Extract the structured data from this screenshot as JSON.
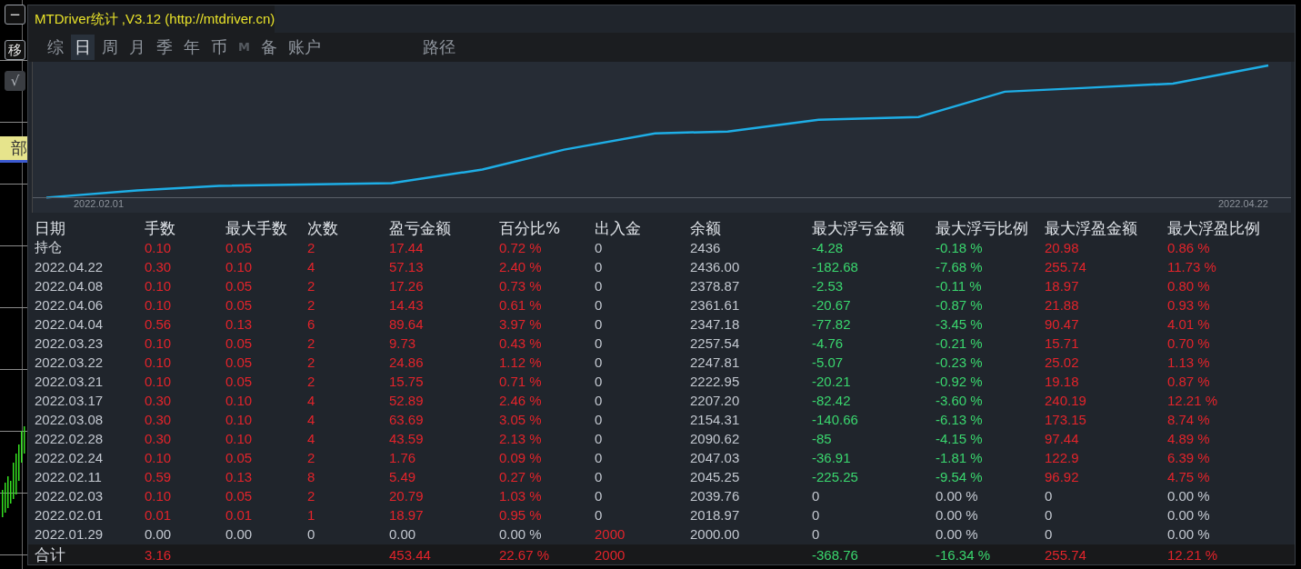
{
  "side_buttons": [
    {
      "label": "−"
    },
    {
      "label": "移"
    },
    {
      "label": "√",
      "disabled": true
    }
  ],
  "side_label": "部",
  "window": {
    "title": "MTDriver统计 ,V3.12 (http://mtdriver.cn)"
  },
  "tabs": [
    {
      "label": "综",
      "selected": false,
      "disabled": false
    },
    {
      "label": "日",
      "selected": true,
      "disabled": false
    },
    {
      "label": "周",
      "selected": false,
      "disabled": false
    },
    {
      "label": "月",
      "selected": false,
      "disabled": false
    },
    {
      "label": "季",
      "selected": false,
      "disabled": false
    },
    {
      "label": "年",
      "selected": false,
      "disabled": false
    },
    {
      "label": "币",
      "selected": false,
      "disabled": false
    },
    {
      "label": "M",
      "selected": false,
      "disabled": true
    },
    {
      "label": "备",
      "selected": false,
      "disabled": false
    },
    {
      "label": "账户",
      "selected": false,
      "disabled": false
    },
    {
      "label": "路径",
      "selected": false,
      "disabled": false
    }
  ],
  "chart": {
    "x_start_label": "2022.02.01",
    "x_end_label": "2022.04.22"
  },
  "table": {
    "columns": [
      "日期",
      "手数",
      "最大手数",
      "次数",
      "盈亏金额",
      "百分比%",
      "出入金",
      "余额",
      "最大浮亏金额",
      "最大浮亏比例",
      "最大浮盈金额",
      "最大浮盈比例"
    ],
    "rows": [
      {
        "cells": [
          {
            "text": "持仓",
            "color": "#d6dae0"
          },
          {
            "text": "0.10",
            "color": "#e3242b"
          },
          {
            "text": "0.05",
            "color": "#e3242b"
          },
          {
            "text": "2",
            "color": "#e3242b"
          },
          {
            "text": "17.44",
            "color": "#e3242b"
          },
          {
            "text": "0.72 %",
            "color": "#e3242b"
          },
          {
            "text": "0",
            "color": "#c3c8d0"
          },
          {
            "text": "2436",
            "color": "#c3c8d0"
          },
          {
            "text": "-4.28",
            "color": "#3ad66e"
          },
          {
            "text": "-0.18 %",
            "color": "#3ad66e"
          },
          {
            "text": "20.98",
            "color": "#e3242b"
          },
          {
            "text": "0.86 %",
            "color": "#e3242b"
          }
        ]
      },
      {
        "cells": [
          {
            "text": "2022.04.22",
            "color": "#c3c8d0"
          },
          {
            "text": "0.30",
            "color": "#e3242b"
          },
          {
            "text": "0.10",
            "color": "#e3242b"
          },
          {
            "text": "4",
            "color": "#e3242b"
          },
          {
            "text": "57.13",
            "color": "#e3242b"
          },
          {
            "text": "2.40 %",
            "color": "#e3242b"
          },
          {
            "text": "0",
            "color": "#c3c8d0"
          },
          {
            "text": "2436.00",
            "color": "#c3c8d0"
          },
          {
            "text": "-182.68",
            "color": "#3ad66e"
          },
          {
            "text": "-7.68 %",
            "color": "#3ad66e"
          },
          {
            "text": "255.74",
            "color": "#e3242b"
          },
          {
            "text": "11.73 %",
            "color": "#e3242b"
          }
        ]
      },
      {
        "cells": [
          {
            "text": "2022.04.08",
            "color": "#c3c8d0"
          },
          {
            "text": "0.10",
            "color": "#e3242b"
          },
          {
            "text": "0.05",
            "color": "#e3242b"
          },
          {
            "text": "2",
            "color": "#e3242b"
          },
          {
            "text": "17.26",
            "color": "#e3242b"
          },
          {
            "text": "0.73 %",
            "color": "#e3242b"
          },
          {
            "text": "0",
            "color": "#c3c8d0"
          },
          {
            "text": "2378.87",
            "color": "#c3c8d0"
          },
          {
            "text": "-2.53",
            "color": "#3ad66e"
          },
          {
            "text": "-0.11 %",
            "color": "#3ad66e"
          },
          {
            "text": "18.97",
            "color": "#e3242b"
          },
          {
            "text": "0.80 %",
            "color": "#e3242b"
          }
        ]
      },
      {
        "cells": [
          {
            "text": "2022.04.06",
            "color": "#c3c8d0"
          },
          {
            "text": "0.10",
            "color": "#e3242b"
          },
          {
            "text": "0.05",
            "color": "#e3242b"
          },
          {
            "text": "2",
            "color": "#e3242b"
          },
          {
            "text": "14.43",
            "color": "#e3242b"
          },
          {
            "text": "0.61 %",
            "color": "#e3242b"
          },
          {
            "text": "0",
            "color": "#c3c8d0"
          },
          {
            "text": "2361.61",
            "color": "#c3c8d0"
          },
          {
            "text": "-20.67",
            "color": "#3ad66e"
          },
          {
            "text": "-0.87 %",
            "color": "#3ad66e"
          },
          {
            "text": "21.88",
            "color": "#e3242b"
          },
          {
            "text": "0.93 %",
            "color": "#e3242b"
          }
        ]
      },
      {
        "cells": [
          {
            "text": "2022.04.04",
            "color": "#c3c8d0"
          },
          {
            "text": "0.56",
            "color": "#e3242b"
          },
          {
            "text": "0.13",
            "color": "#e3242b"
          },
          {
            "text": "6",
            "color": "#e3242b"
          },
          {
            "text": "89.64",
            "color": "#e3242b"
          },
          {
            "text": "3.97 %",
            "color": "#e3242b"
          },
          {
            "text": "0",
            "color": "#c3c8d0"
          },
          {
            "text": "2347.18",
            "color": "#c3c8d0"
          },
          {
            "text": "-77.82",
            "color": "#3ad66e"
          },
          {
            "text": "-3.45 %",
            "color": "#3ad66e"
          },
          {
            "text": "90.47",
            "color": "#e3242b"
          },
          {
            "text": "4.01 %",
            "color": "#e3242b"
          }
        ]
      },
      {
        "cells": [
          {
            "text": "2022.03.23",
            "color": "#c3c8d0"
          },
          {
            "text": "0.10",
            "color": "#e3242b"
          },
          {
            "text": "0.05",
            "color": "#e3242b"
          },
          {
            "text": "2",
            "color": "#e3242b"
          },
          {
            "text": "9.73",
            "color": "#e3242b"
          },
          {
            "text": "0.43 %",
            "color": "#e3242b"
          },
          {
            "text": "0",
            "color": "#c3c8d0"
          },
          {
            "text": "2257.54",
            "color": "#c3c8d0"
          },
          {
            "text": "-4.76",
            "color": "#3ad66e"
          },
          {
            "text": "-0.21 %",
            "color": "#3ad66e"
          },
          {
            "text": "15.71",
            "color": "#e3242b"
          },
          {
            "text": "0.70 %",
            "color": "#e3242b"
          }
        ]
      },
      {
        "cells": [
          {
            "text": "2022.03.22",
            "color": "#c3c8d0"
          },
          {
            "text": "0.10",
            "color": "#e3242b"
          },
          {
            "text": "0.05",
            "color": "#e3242b"
          },
          {
            "text": "2",
            "color": "#e3242b"
          },
          {
            "text": "24.86",
            "color": "#e3242b"
          },
          {
            "text": "1.12 %",
            "color": "#e3242b"
          },
          {
            "text": "0",
            "color": "#c3c8d0"
          },
          {
            "text": "2247.81",
            "color": "#c3c8d0"
          },
          {
            "text": "-5.07",
            "color": "#3ad66e"
          },
          {
            "text": "-0.23 %",
            "color": "#3ad66e"
          },
          {
            "text": "25.02",
            "color": "#e3242b"
          },
          {
            "text": "1.13 %",
            "color": "#e3242b"
          }
        ]
      },
      {
        "cells": [
          {
            "text": "2022.03.21",
            "color": "#c3c8d0"
          },
          {
            "text": "0.10",
            "color": "#e3242b"
          },
          {
            "text": "0.05",
            "color": "#e3242b"
          },
          {
            "text": "2",
            "color": "#e3242b"
          },
          {
            "text": "15.75",
            "color": "#e3242b"
          },
          {
            "text": "0.71 %",
            "color": "#e3242b"
          },
          {
            "text": "0",
            "color": "#c3c8d0"
          },
          {
            "text": "2222.95",
            "color": "#c3c8d0"
          },
          {
            "text": "-20.21",
            "color": "#3ad66e"
          },
          {
            "text": "-0.92 %",
            "color": "#3ad66e"
          },
          {
            "text": "19.18",
            "color": "#e3242b"
          },
          {
            "text": "0.87 %",
            "color": "#e3242b"
          }
        ]
      },
      {
        "cells": [
          {
            "text": "2022.03.17",
            "color": "#c3c8d0"
          },
          {
            "text": "0.30",
            "color": "#e3242b"
          },
          {
            "text": "0.10",
            "color": "#e3242b"
          },
          {
            "text": "4",
            "color": "#e3242b"
          },
          {
            "text": "52.89",
            "color": "#e3242b"
          },
          {
            "text": "2.46 %",
            "color": "#e3242b"
          },
          {
            "text": "0",
            "color": "#c3c8d0"
          },
          {
            "text": "2207.20",
            "color": "#c3c8d0"
          },
          {
            "text": "-82.42",
            "color": "#3ad66e"
          },
          {
            "text": "-3.60 %",
            "color": "#3ad66e"
          },
          {
            "text": "240.19",
            "color": "#e3242b"
          },
          {
            "text": "12.21 %",
            "color": "#e3242b"
          }
        ]
      },
      {
        "cells": [
          {
            "text": "2022.03.08",
            "color": "#c3c8d0"
          },
          {
            "text": "0.30",
            "color": "#e3242b"
          },
          {
            "text": "0.10",
            "color": "#e3242b"
          },
          {
            "text": "4",
            "color": "#e3242b"
          },
          {
            "text": "63.69",
            "color": "#e3242b"
          },
          {
            "text": "3.05 %",
            "color": "#e3242b"
          },
          {
            "text": "0",
            "color": "#c3c8d0"
          },
          {
            "text": "2154.31",
            "color": "#c3c8d0"
          },
          {
            "text": "-140.66",
            "color": "#3ad66e"
          },
          {
            "text": "-6.13 %",
            "color": "#3ad66e"
          },
          {
            "text": "173.15",
            "color": "#e3242b"
          },
          {
            "text": "8.74 %",
            "color": "#e3242b"
          }
        ]
      },
      {
        "cells": [
          {
            "text": "2022.02.28",
            "color": "#c3c8d0"
          },
          {
            "text": "0.30",
            "color": "#e3242b"
          },
          {
            "text": "0.10",
            "color": "#e3242b"
          },
          {
            "text": "4",
            "color": "#e3242b"
          },
          {
            "text": "43.59",
            "color": "#e3242b"
          },
          {
            "text": "2.13 %",
            "color": "#e3242b"
          },
          {
            "text": "0",
            "color": "#c3c8d0"
          },
          {
            "text": "2090.62",
            "color": "#c3c8d0"
          },
          {
            "text": "-85",
            "color": "#3ad66e"
          },
          {
            "text": "-4.15 %",
            "color": "#3ad66e"
          },
          {
            "text": "97.44",
            "color": "#e3242b"
          },
          {
            "text": "4.89 %",
            "color": "#e3242b"
          }
        ]
      },
      {
        "cells": [
          {
            "text": "2022.02.24",
            "color": "#c3c8d0"
          },
          {
            "text": "0.10",
            "color": "#e3242b"
          },
          {
            "text": "0.05",
            "color": "#e3242b"
          },
          {
            "text": "2",
            "color": "#e3242b"
          },
          {
            "text": "1.76",
            "color": "#e3242b"
          },
          {
            "text": "0.09 %",
            "color": "#e3242b"
          },
          {
            "text": "0",
            "color": "#c3c8d0"
          },
          {
            "text": "2047.03",
            "color": "#c3c8d0"
          },
          {
            "text": "-36.91",
            "color": "#3ad66e"
          },
          {
            "text": "-1.81 %",
            "color": "#3ad66e"
          },
          {
            "text": "122.9",
            "color": "#e3242b"
          },
          {
            "text": "6.39 %",
            "color": "#e3242b"
          }
        ]
      },
      {
        "cells": [
          {
            "text": "2022.02.11",
            "color": "#c3c8d0"
          },
          {
            "text": "0.59",
            "color": "#e3242b"
          },
          {
            "text": "0.13",
            "color": "#e3242b"
          },
          {
            "text": "8",
            "color": "#e3242b"
          },
          {
            "text": "5.49",
            "color": "#e3242b"
          },
          {
            "text": "0.27 %",
            "color": "#e3242b"
          },
          {
            "text": "0",
            "color": "#c3c8d0"
          },
          {
            "text": "2045.25",
            "color": "#c3c8d0"
          },
          {
            "text": "-225.25",
            "color": "#3ad66e"
          },
          {
            "text": "-9.54 %",
            "color": "#3ad66e"
          },
          {
            "text": "96.92",
            "color": "#e3242b"
          },
          {
            "text": "4.75 %",
            "color": "#e3242b"
          }
        ]
      },
      {
        "cells": [
          {
            "text": "2022.02.03",
            "color": "#c3c8d0"
          },
          {
            "text": "0.10",
            "color": "#e3242b"
          },
          {
            "text": "0.05",
            "color": "#e3242b"
          },
          {
            "text": "2",
            "color": "#e3242b"
          },
          {
            "text": "20.79",
            "color": "#e3242b"
          },
          {
            "text": "1.03 %",
            "color": "#e3242b"
          },
          {
            "text": "0",
            "color": "#c3c8d0"
          },
          {
            "text": "2039.76",
            "color": "#c3c8d0"
          },
          {
            "text": "0",
            "color": "#c3c8d0"
          },
          {
            "text": "0.00 %",
            "color": "#c3c8d0"
          },
          {
            "text": "0",
            "color": "#c3c8d0"
          },
          {
            "text": "0.00 %",
            "color": "#c3c8d0"
          }
        ]
      },
      {
        "cells": [
          {
            "text": "2022.02.01",
            "color": "#c3c8d0"
          },
          {
            "text": "0.01",
            "color": "#e3242b"
          },
          {
            "text": "0.01",
            "color": "#e3242b"
          },
          {
            "text": "1",
            "color": "#e3242b"
          },
          {
            "text": "18.97",
            "color": "#e3242b"
          },
          {
            "text": "0.95 %",
            "color": "#e3242b"
          },
          {
            "text": "0",
            "color": "#c3c8d0"
          },
          {
            "text": "2018.97",
            "color": "#c3c8d0"
          },
          {
            "text": "0",
            "color": "#c3c8d0"
          },
          {
            "text": "0.00 %",
            "color": "#c3c8d0"
          },
          {
            "text": "0",
            "color": "#c3c8d0"
          },
          {
            "text": "0.00 %",
            "color": "#c3c8d0"
          }
        ]
      },
      {
        "cells": [
          {
            "text": "2022.01.29",
            "color": "#c3c8d0"
          },
          {
            "text": "0.00",
            "color": "#c3c8d0"
          },
          {
            "text": "0.00",
            "color": "#c3c8d0"
          },
          {
            "text": "0",
            "color": "#c3c8d0"
          },
          {
            "text": "0.00",
            "color": "#c3c8d0"
          },
          {
            "text": "0.00 %",
            "color": "#c3c8d0"
          },
          {
            "text": "2000",
            "color": "#e3242b"
          },
          {
            "text": "2000.00",
            "color": "#c3c8d0"
          },
          {
            "text": "0",
            "color": "#c3c8d0"
          },
          {
            "text": "0.00 %",
            "color": "#c3c8d0"
          },
          {
            "text": "0",
            "color": "#c3c8d0"
          },
          {
            "text": "0.00 %",
            "color": "#c3c8d0"
          }
        ]
      }
    ],
    "total": {
      "cells": [
        {
          "text": "合计",
          "color": "#d6dae0"
        },
        {
          "text": "3.16",
          "color": "#e3242b"
        },
        null,
        null,
        {
          "text": "453.44",
          "color": "#e3242b"
        },
        {
          "text": "22.67 %",
          "color": "#e3242b"
        },
        {
          "text": "2000",
          "color": "#e3242b"
        },
        null,
        {
          "text": "-368.76",
          "color": "#3ad66e"
        },
        {
          "text": "-16.34 %",
          "color": "#3ad66e"
        },
        {
          "text": "255.74",
          "color": "#e3242b"
        },
        {
          "text": "12.21 %",
          "color": "#e3242b"
        }
      ]
    }
  }
}
